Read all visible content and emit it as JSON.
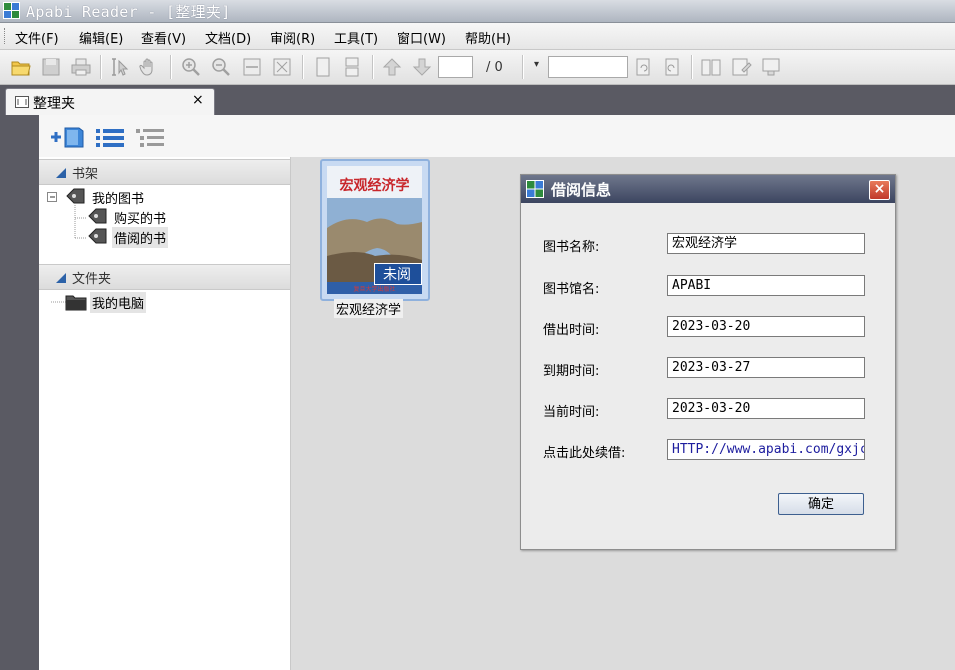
{
  "window": {
    "title": "Apabi Reader - [整理夹]"
  },
  "menu": [
    "文件(F)",
    "编辑(E)",
    "查看(V)",
    "文档(D)",
    "审阅(R)",
    "工具(T)",
    "窗口(W)",
    "帮助(H)"
  ],
  "toolbar": {
    "page_input": "",
    "page_total": "/ 0",
    "zoom_input": ""
  },
  "tab": {
    "label": "整理夹",
    "close": "×"
  },
  "sidebar": {
    "bookshelf": {
      "header": "书架",
      "root": "我的图书",
      "children": [
        "购买的书",
        "借阅的书"
      ]
    },
    "folders": {
      "header": "文件夹",
      "items": [
        "我的电脑"
      ]
    }
  },
  "book": {
    "cover_title": "宏观经济学",
    "badge": "未阅",
    "cover_publisher": "复旦大学出版社",
    "caption": "宏观经济学"
  },
  "dialog": {
    "title": "借阅信息",
    "close": "×",
    "fields": [
      {
        "label": "图书名称:",
        "value": "宏观经济学"
      },
      {
        "label": "图书馆名:",
        "value": "APABI"
      },
      {
        "label": "借出时间:",
        "value": "2023-03-20"
      },
      {
        "label": "到期时间:",
        "value": "2023-03-27"
      },
      {
        "label": "当前时间:",
        "value": "2023-03-20"
      },
      {
        "label": "点击此处续借:",
        "value": "HTTP://www.apabi.com/gxjc"
      }
    ],
    "ok": "确定"
  }
}
